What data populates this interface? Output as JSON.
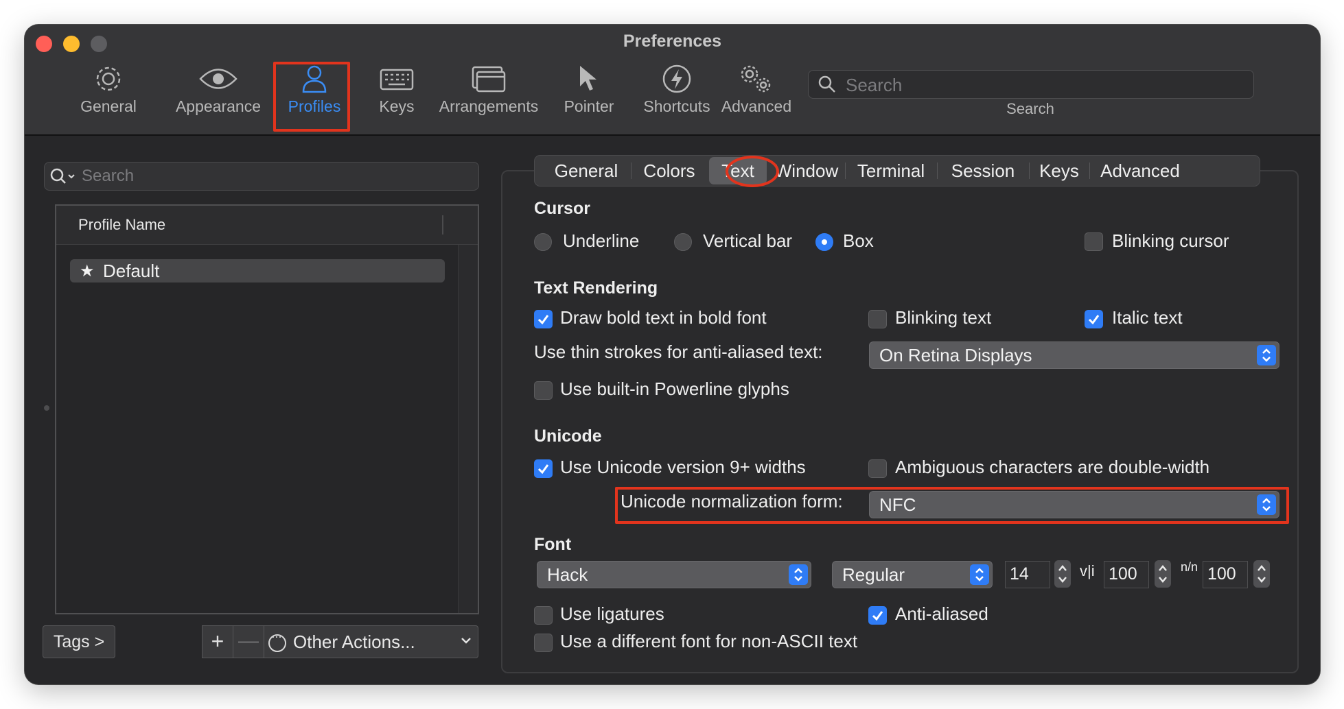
{
  "window": {
    "title": "Preferences"
  },
  "toolbar": {
    "items": [
      {
        "label": "General",
        "icon": "gear-icon"
      },
      {
        "label": "Appearance",
        "icon": "eye-icon"
      },
      {
        "label": "Profiles",
        "icon": "person-icon",
        "selected": true
      },
      {
        "label": "Keys",
        "icon": "keyboard-icon"
      },
      {
        "label": "Arrangements",
        "icon": "windows-icon"
      },
      {
        "label": "Pointer",
        "icon": "pointer-icon"
      },
      {
        "label": "Shortcuts",
        "icon": "bolt-icon"
      },
      {
        "label": "Advanced",
        "icon": "gears-icon"
      }
    ],
    "search_placeholder": "Search",
    "search_label": "Search"
  },
  "profiles": {
    "search_placeholder": "Search",
    "column_header": "Profile Name",
    "rows": [
      {
        "name": "Default",
        "is_default": true
      }
    ],
    "tags_button": "Tags >",
    "add_button": "+",
    "remove_button": "—",
    "other_actions": "Other Actions..."
  },
  "tabs": [
    "General",
    "Colors",
    "Text",
    "Window",
    "Terminal",
    "Session",
    "Keys",
    "Advanced"
  ],
  "selected_tab": "Text",
  "cursor": {
    "title": "Cursor",
    "options": [
      "Underline",
      "Vertical bar",
      "Box"
    ],
    "selected": "Box",
    "blinking_label": "Blinking cursor",
    "blinking": false
  },
  "text_rendering": {
    "title": "Text Rendering",
    "bold_label": "Draw bold text in bold font",
    "bold": true,
    "blink_label": "Blinking text",
    "blink": false,
    "italic_label": "Italic text",
    "italic": true,
    "thin_strokes_label": "Use thin strokes for anti-aliased text:",
    "thin_strokes_value": "On Retina Displays",
    "powerline_label": "Use built-in Powerline glyphs",
    "powerline": false
  },
  "unicode": {
    "title": "Unicode",
    "v9_label": "Use Unicode version 9+ widths",
    "v9": true,
    "ambiguous_label": "Ambiguous characters are double-width",
    "ambiguous": false,
    "normalization_label": "Unicode normalization form:",
    "normalization_value": "NFC"
  },
  "font": {
    "title": "Font",
    "family": "Hack",
    "style": "Regular",
    "size": "14",
    "h_spacing_icon": "v|i",
    "h_spacing": "100",
    "v_spacing_icon": "n/n",
    "v_spacing": "100",
    "ligatures_label": "Use ligatures",
    "ligatures": false,
    "antialiased_label": "Anti-aliased",
    "antialiased": true,
    "non_ascii_label": "Use a different font for non-ASCII text",
    "non_ascii": false
  },
  "colors": {
    "accent": "#2f7cf6",
    "highlight": "#e2341d",
    "window_bg": "#272729"
  }
}
